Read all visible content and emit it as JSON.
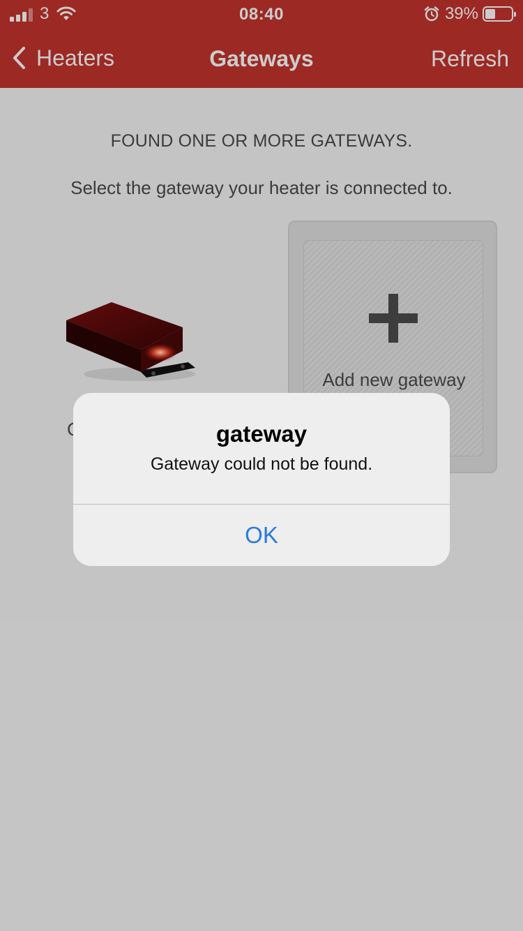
{
  "status_bar": {
    "carrier": "3",
    "time": "08:40",
    "battery_percent": "39%",
    "battery_level": 0.39,
    "signal_icon": "cellular-signal-icon",
    "wifi_icon": "wifi-icon",
    "alarm_icon": "alarm-clock-icon"
  },
  "nav": {
    "back_label": "Heaters",
    "title": "Gateways",
    "refresh_label": "Refresh",
    "back_icon": "chevron-left-icon"
  },
  "content": {
    "heading": "FOUND ONE OR MORE GATEWAYS.",
    "instruction": "Select the gateway your heater is connected to.",
    "gateway_name_partial": "C",
    "add_gateway_label": "Add new gateway"
  },
  "alert": {
    "title": "gateway",
    "message": "Gateway could not be found.",
    "ok_label": "OK"
  },
  "colors": {
    "brand_red": "#c4342c",
    "alert_button_blue": "#2a7ae2",
    "dim_overlay": "rgba(0,0,0,0.2)"
  }
}
